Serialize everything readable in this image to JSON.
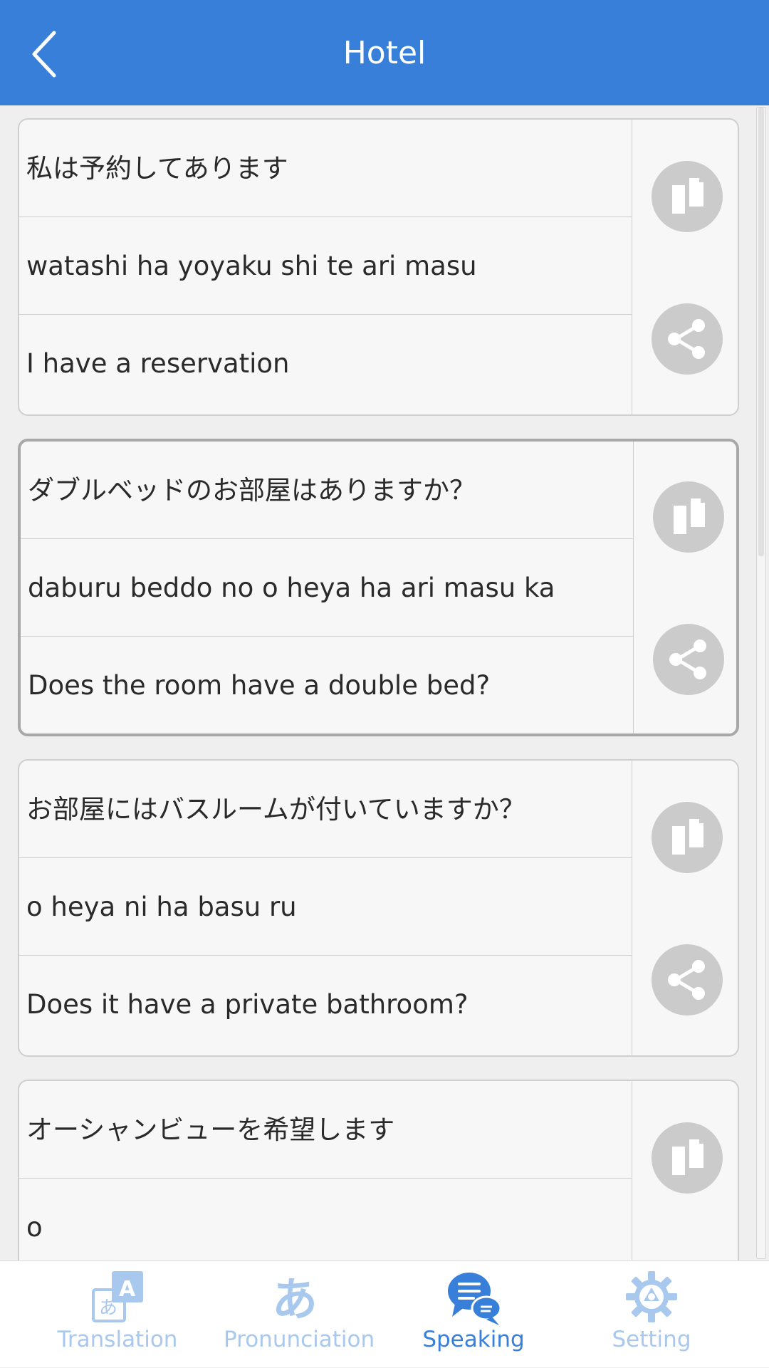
{
  "header": {
    "title": "Hotel",
    "back_icon": "chevron-left-icon"
  },
  "phrases": [
    {
      "japanese": "私は予約してあります",
      "romaji": "watashi ha yoyaku shi te ari masu",
      "english": "I have a reservation"
    },
    {
      "japanese": "ダブルベッドのお部屋はありますか？",
      "romaji": "daburu beddo no o heya ha ari masu ka",
      "english": "Does the room have a double bed?"
    },
    {
      "japanese": "お部屋にはバスルームが付いていますか？",
      "romaji": "o heya ni ha basu ru",
      "english": "Does it have a private bathroom?"
    },
    {
      "japanese": "オーシャンビューを希望します",
      "romaji": "o",
      "english": ""
    }
  ],
  "actions": {
    "copy_icon": "copy-icon",
    "share_icon": "share-icon"
  },
  "nav": {
    "items": [
      {
        "label": "Translation",
        "icon": "translation-icon",
        "active": false
      },
      {
        "label": "Pronunciation",
        "icon": "hiragana-icon",
        "active": false
      },
      {
        "label": "Speaking",
        "icon": "chat-bubbles-icon",
        "active": true
      },
      {
        "label": "Setting",
        "icon": "gear-icon",
        "active": false
      }
    ]
  },
  "colors": {
    "primary": "#377fd9",
    "inactive_nav": "#a9c8ee",
    "button_grey": "#cbcbcb"
  }
}
